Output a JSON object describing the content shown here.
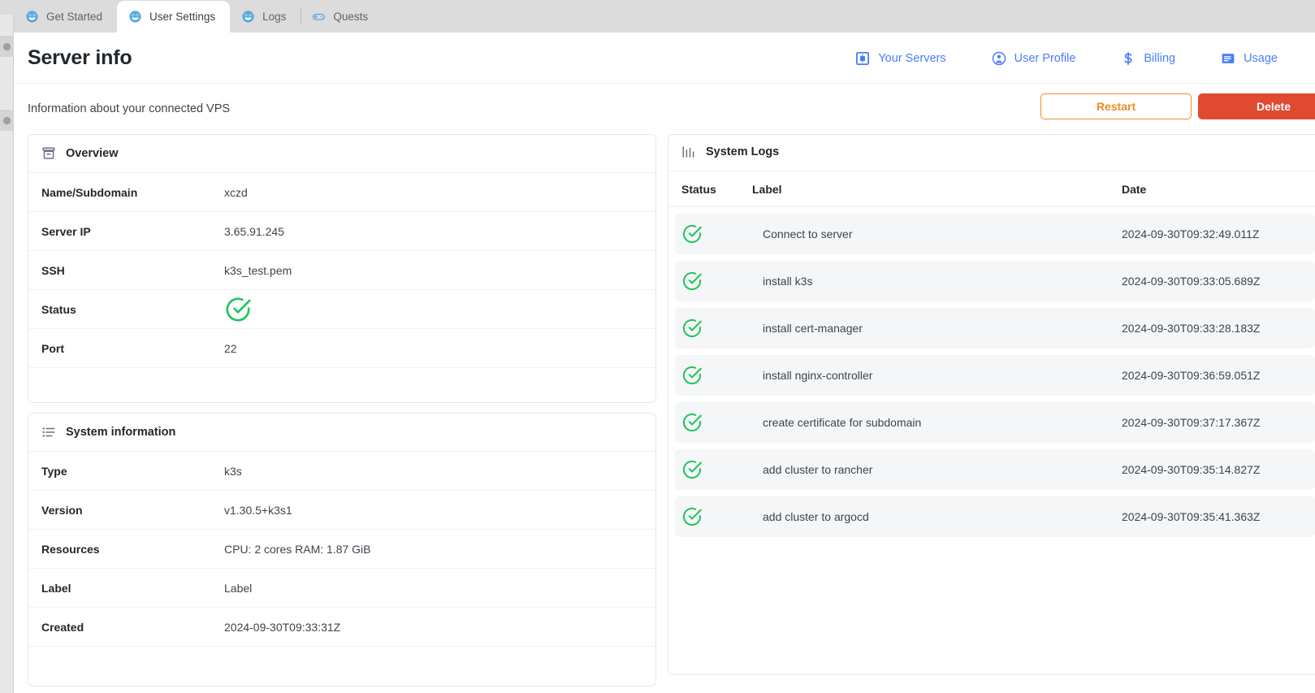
{
  "browser": {
    "tabs": [
      {
        "label": "Get Started",
        "favicon": "smiley-face-icon",
        "active": false
      },
      {
        "label": "User Settings",
        "favicon": "smiley-face-icon",
        "active": true
      },
      {
        "label": "Logs",
        "favicon": "smiley-face-icon",
        "active": false
      },
      {
        "label": "Quests",
        "favicon": "gamepad-icon",
        "active": false
      }
    ]
  },
  "header": {
    "title": "Server info",
    "nav": [
      {
        "label": "Your Servers",
        "icon": "server-box-icon"
      },
      {
        "label": "User Profile",
        "icon": "user-avatar-icon"
      },
      {
        "label": "Billing",
        "icon": "dollar-sign-icon"
      },
      {
        "label": "Usage",
        "icon": "document-lines-icon"
      }
    ]
  },
  "subbar": {
    "description": "Information about your connected VPS",
    "restart_label": "Restart",
    "delete_label": "Delete"
  },
  "overview": {
    "title": "Overview",
    "icon": "archive-box-icon",
    "rows": [
      {
        "key": "Name/Subdomain",
        "value": "xczd"
      },
      {
        "key": "Server IP",
        "value": "3.65.91.245"
      },
      {
        "key": "SSH",
        "value": "k3s_test.pem"
      },
      {
        "key": "Status",
        "value": "",
        "status_icon": "check-circle-icon"
      },
      {
        "key": "Port",
        "value": "22"
      }
    ]
  },
  "system_information": {
    "title": "System information",
    "icon": "list-icon",
    "rows": [
      {
        "key": "Type",
        "value": "k3s"
      },
      {
        "key": "Version",
        "value": "v1.30.5+k3s1"
      },
      {
        "key": "Resources",
        "value": "CPU: 2 cores RAM: 1.87 GiB"
      },
      {
        "key": "Label",
        "value": "Label"
      },
      {
        "key": "Created",
        "value": "2024-09-30T09:33:31Z"
      }
    ]
  },
  "system_logs": {
    "title": "System Logs",
    "icon": "bar-chart-icon",
    "columns": {
      "status": "Status",
      "label": "Label",
      "date": "Date"
    },
    "rows": [
      {
        "status": "success",
        "label": "Connect to server",
        "date": "2024-09-30T09:32:49.011Z"
      },
      {
        "status": "success",
        "label": "install k3s",
        "date": "2024-09-30T09:33:05.689Z"
      },
      {
        "status": "success",
        "label": "install cert-manager",
        "date": "2024-09-30T09:33:28.183Z"
      },
      {
        "status": "success",
        "label": "install nginx-controller",
        "date": "2024-09-30T09:36:59.051Z"
      },
      {
        "status": "success",
        "label": "create certificate for subdomain",
        "date": "2024-09-30T09:37:17.367Z"
      },
      {
        "status": "success",
        "label": "add cluster to rancher",
        "date": "2024-09-30T09:35:14.827Z"
      },
      {
        "status": "success",
        "label": "add cluster to argocd",
        "date": "2024-09-30T09:35:41.363Z"
      }
    ]
  },
  "colors": {
    "accent_blue": "#4a7dfc",
    "success_green": "#22c55e",
    "warning_orange": "#ee8b24",
    "danger_red": "#e04a31",
    "text_dark": "#22272e"
  }
}
